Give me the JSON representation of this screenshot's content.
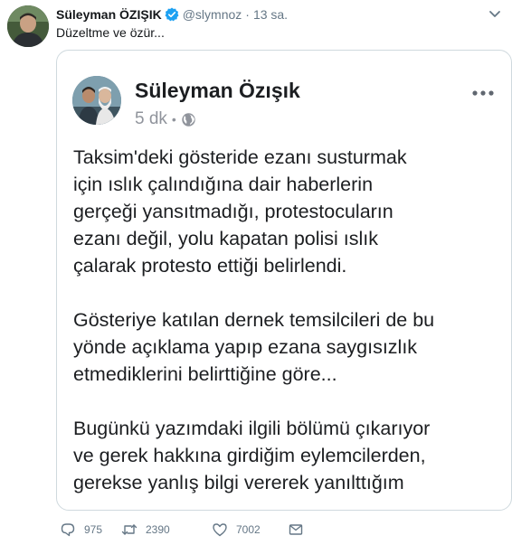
{
  "tweet": {
    "author_name": "Süleyman ÖZIŞIK",
    "author_handle": "@slymnoz",
    "separator": "·",
    "time": "13 sa.",
    "text": "Düzeltme ve özür..."
  },
  "embedded_post": {
    "author_name": "Süleyman Özışık",
    "time": "5 dk",
    "meta_separator": "•",
    "paragraphs": [
      [
        "Taksim'deki gösteride ezanı susturmak",
        "için ıslık çalındığına dair haberlerin",
        "gerçeği yansıtmadığı, protestocuların",
        "ezanı değil, yolu kapatan polisi ıslık",
        "çalarak protesto ettiği belirlendi."
      ],
      [
        "Gösteriye katılan dernek temsilcileri de bu",
        "yönde açıklama yapıp ezana saygısızlık",
        "etmediklerini belirttiğine göre..."
      ],
      [
        "Bugünkü yazımdaki ilgili bölümü çıkarıyor",
        "ve gerek hakkına girdiğim eylemcilerden,",
        "gerekse yanlış bilgi vererek yanılttığım"
      ]
    ]
  },
  "actions": {
    "reply_count": "975",
    "retweet_count": "2390",
    "like_count": "7002"
  },
  "icons": {
    "verified": "verified-badge-icon",
    "caret": "chevron-down-icon",
    "globe": "globe-icon",
    "more": "more-options-icon",
    "reply": "reply-icon",
    "retweet": "retweet-icon",
    "like": "heart-icon",
    "message": "envelope-icon"
  },
  "colors": {
    "verified_blue": "#1da1f2",
    "secondary_text": "#657786",
    "fb_meta": "#90949c"
  }
}
